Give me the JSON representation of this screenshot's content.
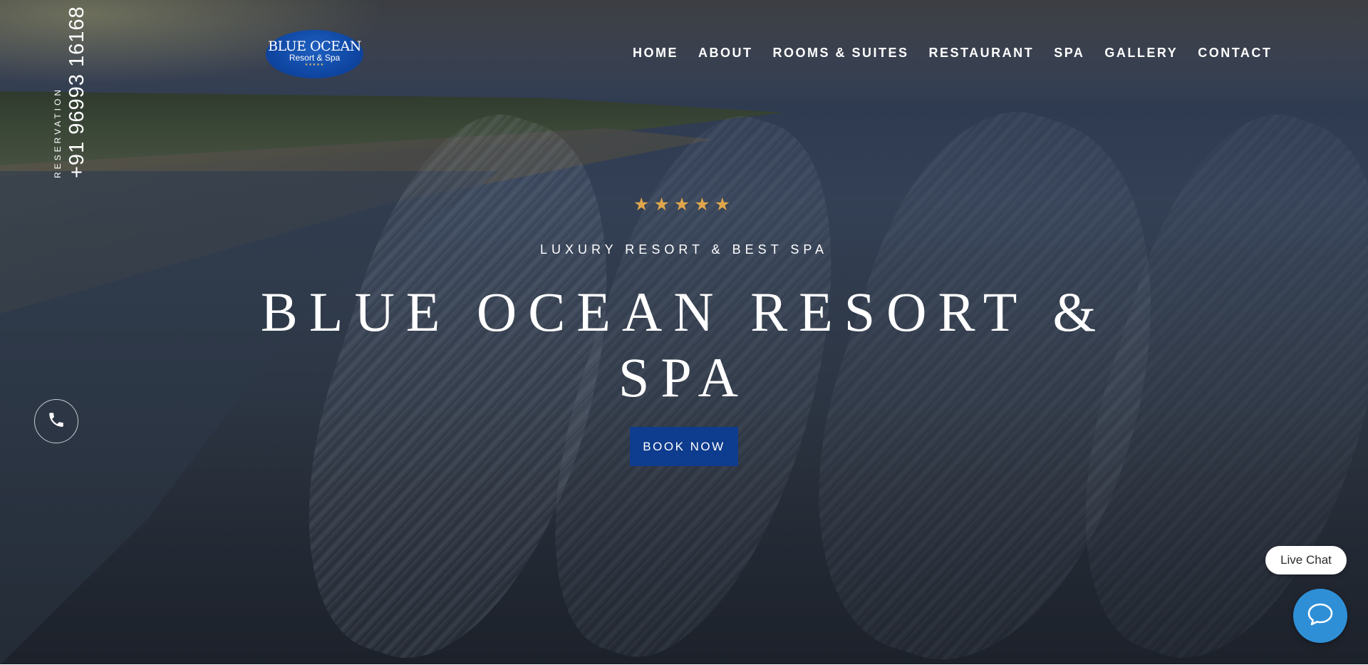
{
  "brand": {
    "logo_line1": "BLUE OCEAN",
    "logo_line2": "Resort & Spa",
    "logo_line3": "★★★★★",
    "logo_color": "#0f47a3"
  },
  "nav": {
    "items": [
      {
        "label": "HOME"
      },
      {
        "label": "ABOUT"
      },
      {
        "label": "ROOMS & SUITES"
      },
      {
        "label": "RESTAURANT"
      },
      {
        "label": "SPA"
      },
      {
        "label": "GALLERY"
      },
      {
        "label": "CONTACT"
      }
    ]
  },
  "hero": {
    "stars": "★★★★★",
    "star_color": "#e0a64b",
    "tagline": "LUXURY RESORT & BEST SPA",
    "title": "BLUE OCEAN RESORT & SPA",
    "cta_label": "BOOK NOW",
    "cta_color": "#0e3c8e"
  },
  "reservation": {
    "label": "RESERVATION",
    "phone": "+91 96993 16168",
    "icon": "phone-icon"
  },
  "chat": {
    "label": "Live Chat",
    "icon": "chat-bubble-icon",
    "color": "#2f8fd6"
  }
}
